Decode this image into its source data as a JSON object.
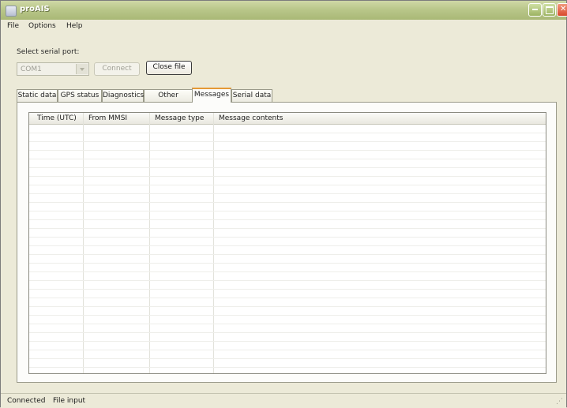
{
  "window": {
    "title": "proAIS"
  },
  "menu": [
    "File",
    "Options",
    "Help"
  ],
  "serial": {
    "label": "Select serial port:",
    "port": "COM1",
    "connect_label": "Connect",
    "close_file_label": "Close file"
  },
  "tabs": [
    {
      "label": "Static data",
      "active": false
    },
    {
      "label": "GPS status",
      "active": false
    },
    {
      "label": "Diagnostics",
      "active": false
    },
    {
      "label": "Other Vessels",
      "active": false
    },
    {
      "label": "Messages",
      "active": true
    },
    {
      "label": "Serial data",
      "active": false
    }
  ],
  "messages_table": {
    "columns": [
      "Time (UTC)",
      "From MMSI",
      "Message type",
      "Message contents"
    ],
    "rows": []
  },
  "status": {
    "connection": "Connected",
    "mode": "File input"
  }
}
